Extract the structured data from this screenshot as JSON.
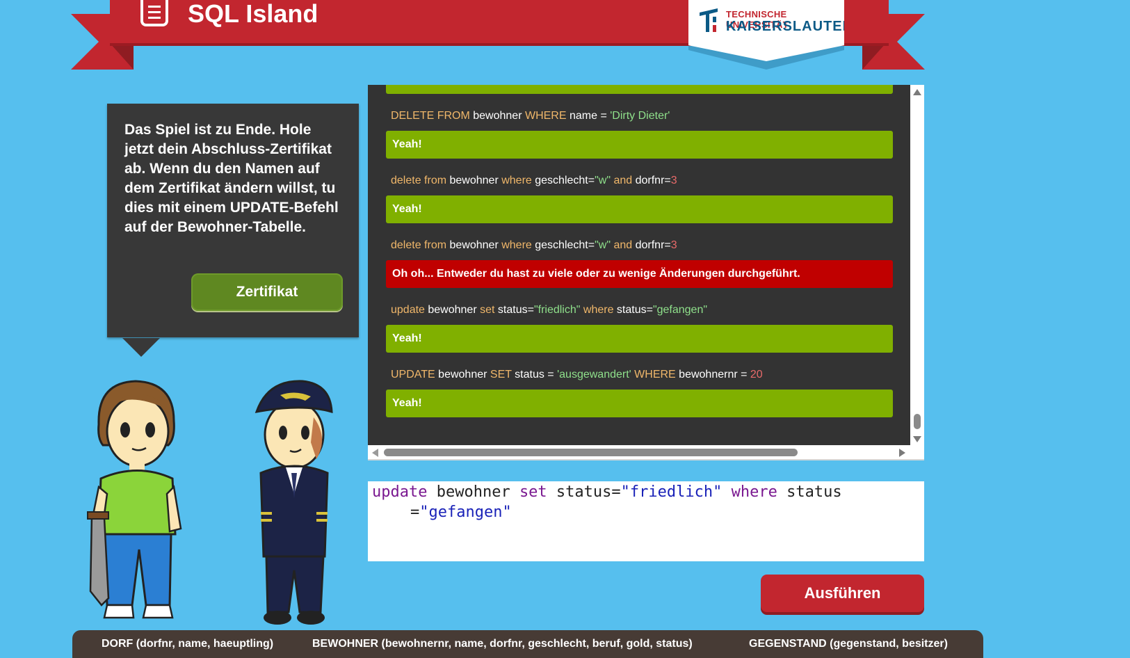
{
  "header": {
    "title": "SQL Island",
    "logo": {
      "line1": "TECHNISCHE UNIVERSITÄT",
      "line2": "KAISERSLAUTERN"
    }
  },
  "info_box": {
    "text": "Das Spiel ist zu Ende. Hole jetzt dein Abschluss-Zertifikat ab. Wenn du den Namen auf dem Zertifikat ändern willst, tu dies mit einem UPDATE-Befehl auf der Bewohner-Tabelle.",
    "button_label": "Zertifikat"
  },
  "log": {
    "entries": [
      {
        "tokens": [
          {
            "t": "DELETE FROM",
            "k": "kw"
          },
          {
            "t": " bewohner ",
            "k": "id"
          },
          {
            "t": "WHERE",
            "k": "kw"
          },
          {
            "t": " name = ",
            "k": "id"
          },
          {
            "t": "'Dirty Dieter'",
            "k": "str"
          }
        ],
        "result": "Yeah!",
        "status": "ok"
      },
      {
        "tokens": [
          {
            "t": "delete from",
            "k": "kw"
          },
          {
            "t": " bewohner ",
            "k": "id"
          },
          {
            "t": "where",
            "k": "kw"
          },
          {
            "t": " geschlecht=",
            "k": "id"
          },
          {
            "t": "\"w\"",
            "k": "str"
          },
          {
            "t": " and ",
            "k": "kw"
          },
          {
            "t": "dorfnr=",
            "k": "id"
          },
          {
            "t": "3",
            "k": "num"
          }
        ],
        "result": "Yeah!",
        "status": "ok"
      },
      {
        "tokens": [
          {
            "t": "delete from",
            "k": "kw"
          },
          {
            "t": " bewohner ",
            "k": "id"
          },
          {
            "t": "where",
            "k": "kw"
          },
          {
            "t": " geschlecht=",
            "k": "id"
          },
          {
            "t": "\"w\"",
            "k": "str"
          },
          {
            "t": " and ",
            "k": "kw"
          },
          {
            "t": "dorfnr=",
            "k": "id"
          },
          {
            "t": "3",
            "k": "num"
          }
        ],
        "result": "Oh oh... Entweder du hast zu viele oder zu wenige Änderungen durchgeführt.",
        "status": "err"
      },
      {
        "tokens": [
          {
            "t": "update",
            "k": "kw"
          },
          {
            "t": " bewohner ",
            "k": "id"
          },
          {
            "t": "set",
            "k": "kw"
          },
          {
            "t": " status=",
            "k": "id"
          },
          {
            "t": "\"friedlich\"",
            "k": "str"
          },
          {
            "t": " where ",
            "k": "kw"
          },
          {
            "t": "status=",
            "k": "id"
          },
          {
            "t": "\"gefangen\"",
            "k": "str"
          }
        ],
        "result": "Yeah!",
        "status": "ok"
      },
      {
        "tokens": [
          {
            "t": "UPDATE",
            "k": "kw"
          },
          {
            "t": " bewohner ",
            "k": "id"
          },
          {
            "t": "SET",
            "k": "kw"
          },
          {
            "t": " status = ",
            "k": "id"
          },
          {
            "t": "'ausgewandert'",
            "k": "str"
          },
          {
            "t": " WHERE",
            "k": "kw"
          },
          {
            "t": " bewohnernr = ",
            "k": "id"
          },
          {
            "t": "20",
            "k": "num"
          }
        ],
        "result": "Yeah!",
        "status": "ok"
      }
    ]
  },
  "editor": {
    "line1": [
      {
        "t": "update",
        "k": "kw"
      },
      {
        "t": " bewohner ",
        "k": "id"
      },
      {
        "t": "set",
        "k": "kw"
      },
      {
        "t": " status=",
        "k": "id"
      },
      {
        "t": "\"friedlich\"",
        "k": "str"
      },
      {
        "t": " where",
        "k": "kw"
      },
      {
        "t": " status",
        "k": "id"
      }
    ],
    "line2": [
      {
        "t": "=",
        "k": "id"
      },
      {
        "t": "\"gefangen\"",
        "k": "str"
      }
    ]
  },
  "run_button_label": "Ausführen",
  "schema": {
    "dorf": "DORF (dorfnr, name, haeuptling)",
    "bewohner": "BEWOHNER (bewohnernr, name, dorfnr, geschlecht, beruf, gold, status)",
    "gegenstand": "GEGENSTAND (gegenstand, besitzer)"
  },
  "colors": {
    "background": "#56bfee",
    "banner": "#c2262f",
    "success": "#80b000",
    "error": "#c00000",
    "panel": "#333333"
  }
}
